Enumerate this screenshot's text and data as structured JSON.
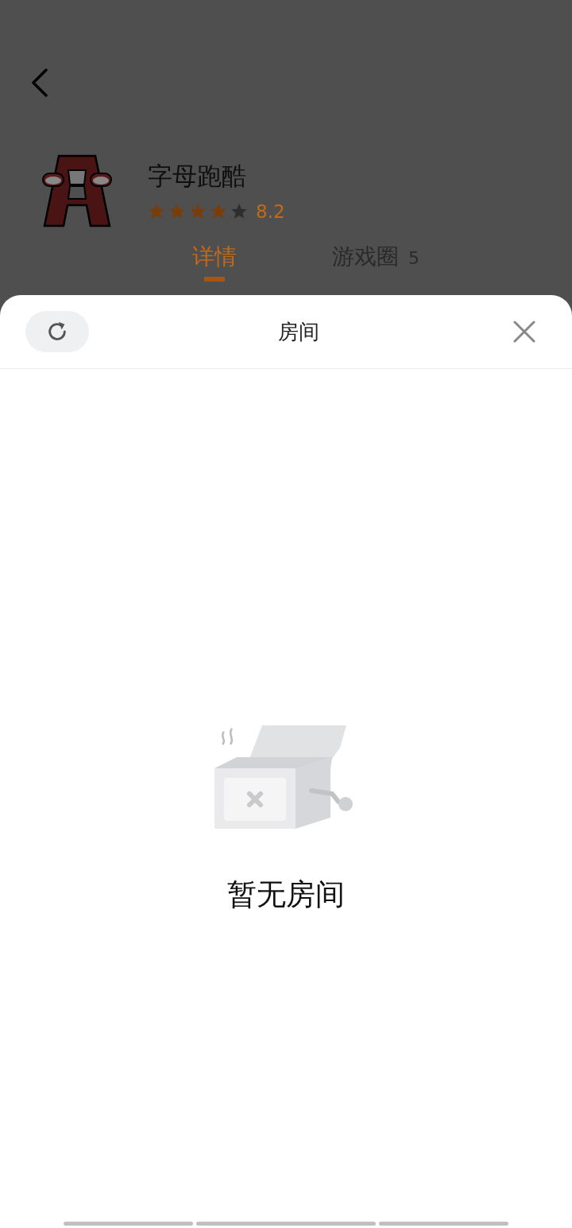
{
  "app": {
    "name": "字母跑酷",
    "stars": 4,
    "rating": "8.2"
  },
  "tabs": [
    {
      "label": "详情",
      "selected": true
    },
    {
      "label": "游戏圈",
      "count": "5",
      "selected": false
    }
  ],
  "sheet": {
    "title": "房间",
    "empty_text": "暂无房间"
  }
}
